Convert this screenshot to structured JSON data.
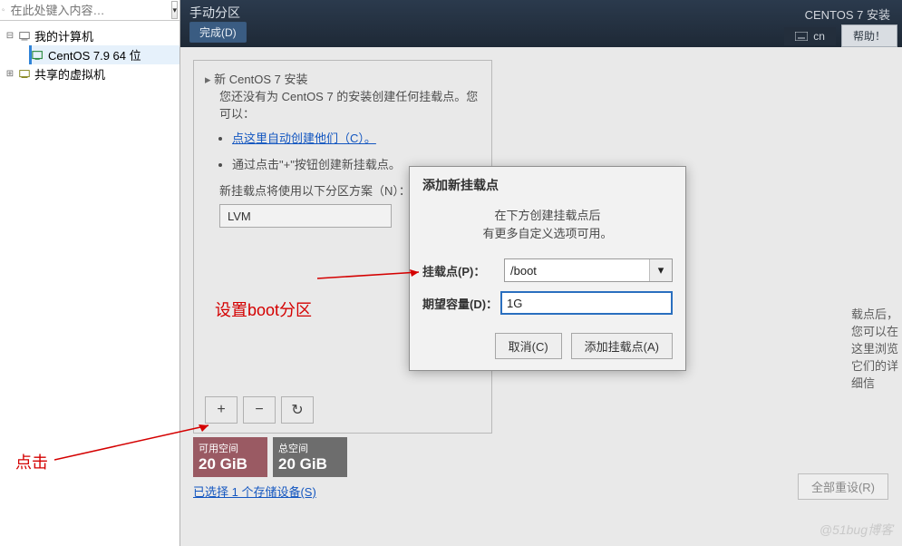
{
  "left": {
    "search_placeholder": "在此处键入内容…",
    "root": "我的计算机",
    "vm": "CentOS 7.9 64 位",
    "shared": "共享的虚拟机"
  },
  "topbar": {
    "title": "手动分区",
    "done": "完成(D)",
    "right_title": "CENTOS 7 安装",
    "kbd": "cn",
    "help": "帮助！"
  },
  "partbox": {
    "heading": "新 CentOS 7 安装",
    "desc1": "您还没有为 CentOS 7 的安装创建任何挂载点。您可以：",
    "link_auto": "点这里自动创建他们（C）。",
    "bullet_manual": "通过点击\"+\"按钮创建新挂载点。",
    "scheme_label": "新挂载点将使用以下分区方案（N）：",
    "scheme_value": "LVM",
    "btn_plus": "+",
    "btn_minus": "−",
    "btn_refresh": "↻"
  },
  "right_hint": "载点后，您可以在这里浏览它们的详细信",
  "space": {
    "avail_label": "可用空间",
    "avail_val": "20 GiB",
    "total_label": "总空间",
    "total_val": "20 GiB"
  },
  "bottom_link": "已选择 1 个存储设备(S)",
  "reset": "全部重设(R)",
  "dialog": {
    "title": "添加新挂载点",
    "desc1": "在下方创建挂载点后",
    "desc2": "有更多自定义选项可用。",
    "label_mp": "挂载点(P)：",
    "value_mp": "/boot",
    "label_size": "期望容量(D)：",
    "value_size": "1G",
    "cancel": "取消(C)",
    "add": "添加挂载点(A)"
  },
  "anno": {
    "set_boot": "设置boot分区",
    "click": "点击"
  },
  "watermark": "@51bug博客"
}
